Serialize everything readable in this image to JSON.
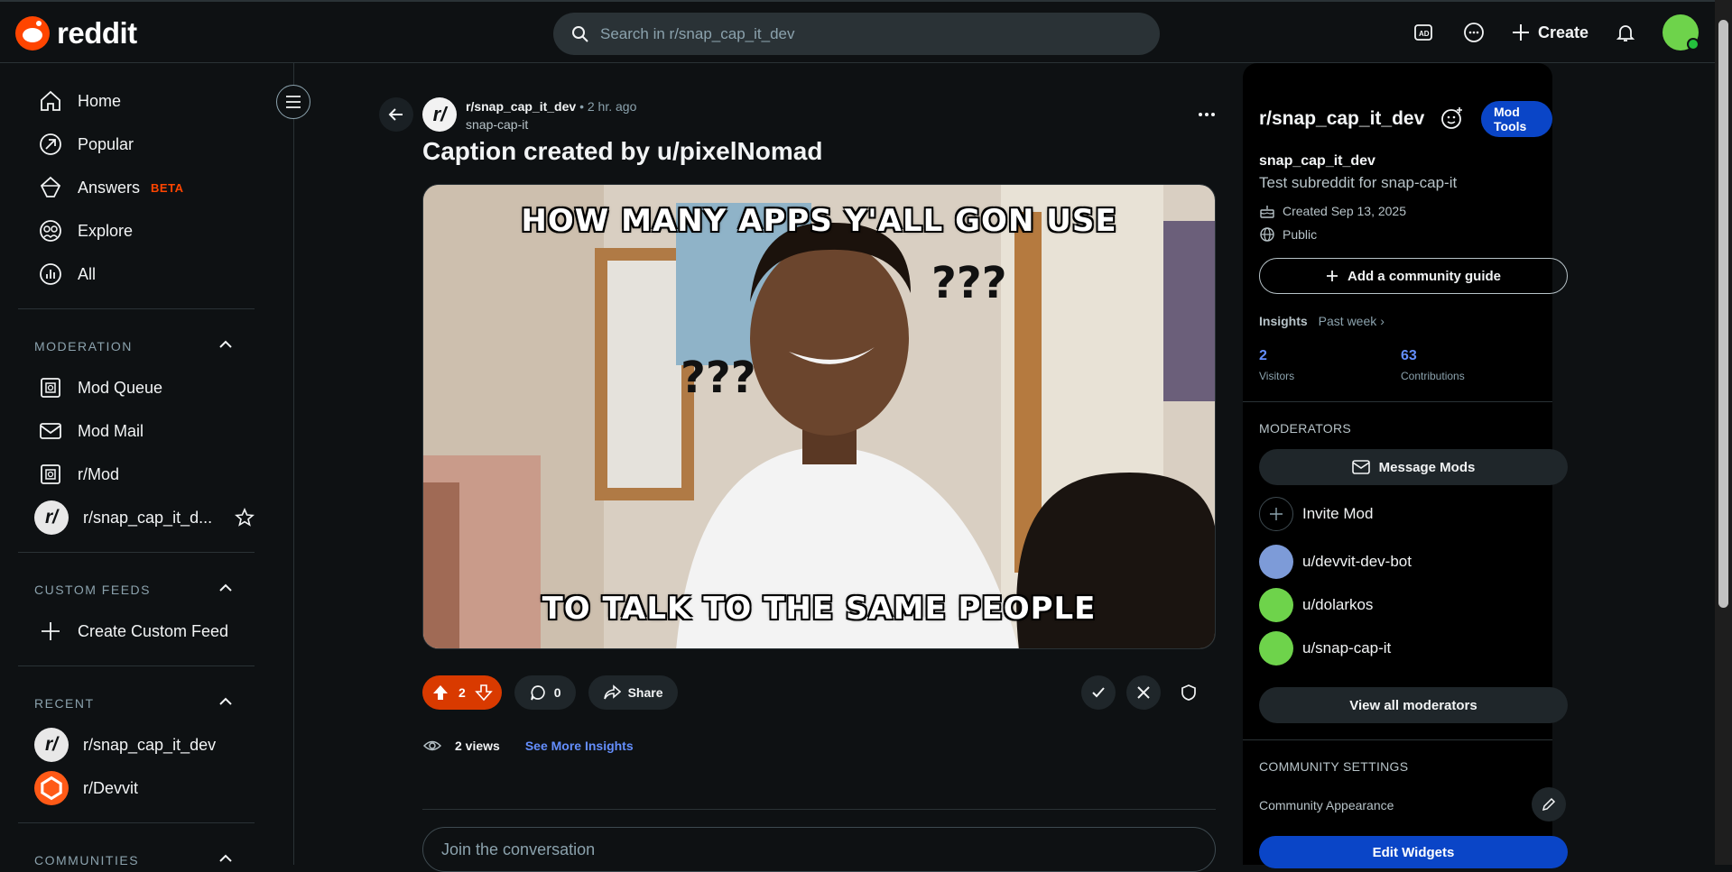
{
  "header": {
    "logo_text": "reddit",
    "search_placeholder": "Search in r/snap_cap_it_dev",
    "create_label": "Create"
  },
  "sidebar": {
    "nav": [
      {
        "label": "Home",
        "icon": "home-icon"
      },
      {
        "label": "Popular",
        "icon": "popular-icon"
      },
      {
        "label": "Answers",
        "badge": "BETA",
        "icon": "answers-icon"
      },
      {
        "label": "Explore",
        "icon": "explore-icon"
      },
      {
        "label": "All",
        "icon": "all-icon"
      }
    ],
    "moderation_heading": "MODERATION",
    "moderation": [
      {
        "label": "Mod Queue"
      },
      {
        "label": "Mod Mail"
      },
      {
        "label": "r/Mod"
      },
      {
        "label": "r/snap_cap_it_d..."
      }
    ],
    "custom_feeds_heading": "CUSTOM FEEDS",
    "create_custom_feed": "Create Custom Feed",
    "recent_heading": "RECENT",
    "recent": [
      {
        "label": "r/snap_cap_it_dev"
      },
      {
        "label": "r/Devvit"
      }
    ],
    "communities_heading": "COMMUNITIES"
  },
  "post": {
    "subreddit": "r/snap_cap_it_dev",
    "separator": "•",
    "time": "2 hr. ago",
    "author": "snap-cap-it",
    "title": "Caption created by u/pixelNomad",
    "meme_top": "HOW MANY APPS Y'ALL GON USE",
    "meme_bottom": "TO TALK TO THE SAME PEOPLE",
    "meme_marks_1": "???",
    "meme_marks_2": "???",
    "votes": "2",
    "comments": "0",
    "share_label": "Share",
    "views": "2 views",
    "see_more": "See More Insights",
    "comment_placeholder": "Join the conversation"
  },
  "community": {
    "name": "r/snap_cap_it_dev",
    "mod_tools": "Mod Tools",
    "display_name": "snap_cap_it_dev",
    "description": "Test subreddit for snap-cap-it",
    "created": "Created Sep 13, 2025",
    "visibility": "Public",
    "add_guide": "Add a community guide",
    "insights_label": "Insights",
    "insights_period": "Past week",
    "visitors_value": "2",
    "visitors_label": "Visitors",
    "contributions_value": "63",
    "contributions_label": "Contributions",
    "moderators_heading": "MODERATORS",
    "message_mods": "Message Mods",
    "invite_mod": "Invite Mod",
    "moderators": [
      {
        "name": "u/devvit-dev-bot",
        "color": "#7d9bd8"
      },
      {
        "name": "u/dolarkos",
        "color": "#6ed34b"
      },
      {
        "name": "u/snap-cap-it",
        "color": "#6ed34b"
      }
    ],
    "view_all_mods": "View all moderators",
    "settings_heading": "COMMUNITY SETTINGS",
    "appearance_label": "Community Appearance",
    "edit_widgets": "Edit Widgets"
  },
  "colors": {
    "accent": "#ff4500",
    "upvote": "#d93a00",
    "link": "#648efc",
    "primary_button": "#0a45c7",
    "background": "#0e1113"
  }
}
